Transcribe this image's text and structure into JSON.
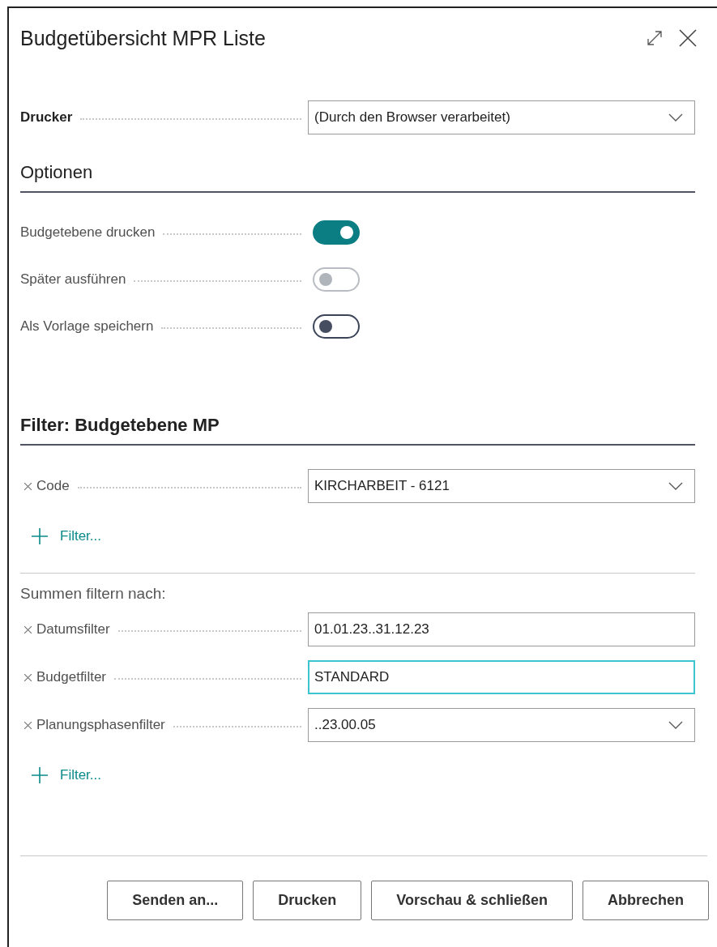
{
  "window": {
    "title": "Budgetübersicht MPR Liste"
  },
  "printer": {
    "label": "Drucker",
    "value": "(Durch den Browser verarbeitet)",
    "kind": "dropdown"
  },
  "options": {
    "heading": "Optionen",
    "items": [
      {
        "label": "Budgetebene drucken",
        "on": true,
        "disabled": false
      },
      {
        "label": "Später ausführen",
        "on": false,
        "disabled": true
      },
      {
        "label": "Als Vorlage speichern",
        "on": false,
        "disabled": false
      }
    ]
  },
  "filter_section": {
    "heading": "Filter: Budgetebene MP",
    "filters": [
      {
        "label": "Code",
        "value": "KIRCHARBEIT - 6121",
        "kind": "dropdown",
        "focused": false
      }
    ],
    "add_filter": "Filter..."
  },
  "totals_section": {
    "heading": "Summen filtern nach:",
    "filters": [
      {
        "label": "Datumsfilter",
        "value": "01.01.23..31.12.23",
        "kind": "text",
        "focused": false
      },
      {
        "label": "Budgetfilter",
        "value": "STANDARD",
        "kind": "text",
        "focused": true
      },
      {
        "label": "Planungsphasenfilter",
        "value": "..23.00.05",
        "kind": "dropdown",
        "focused": false
      }
    ],
    "add_filter": "Filter..."
  },
  "buttons": [
    "Senden an...",
    "Drucken",
    "Vorschau & schließen",
    "Abbrechen"
  ]
}
